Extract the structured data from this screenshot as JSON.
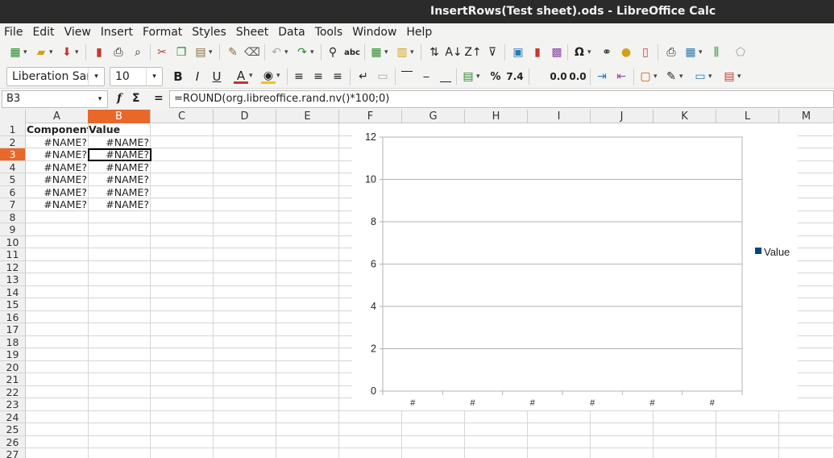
{
  "window": {
    "title": "InsertRows(Test sheet).ods - LibreOffice Calc"
  },
  "menu": [
    "File",
    "Edit",
    "View",
    "Insert",
    "Format",
    "Styles",
    "Sheet",
    "Data",
    "Tools",
    "Window",
    "Help"
  ],
  "formatting": {
    "font_name": "Liberation Sar",
    "font_size": "10"
  },
  "formula_bar": {
    "name_box": "B3",
    "fx": "f",
    "sigma": "Σ",
    "equals": "=",
    "formula": "=ROUND(org.libreoffice.rand.nv()*100;0)"
  },
  "sheet": {
    "columns": [
      "A",
      "B",
      "C",
      "D",
      "E",
      "F",
      "G",
      "H",
      "I",
      "J",
      "K",
      "L",
      "M"
    ],
    "selected_column": "B",
    "rows": [
      "1",
      "2",
      "3",
      "4",
      "5",
      "6",
      "7",
      "8",
      "9",
      "10",
      "11",
      "12",
      "13",
      "14",
      "15",
      "16",
      "17",
      "18",
      "19",
      "20",
      "21",
      "22",
      "23",
      "24",
      "25",
      "26",
      "27"
    ],
    "selected_row": "3",
    "cells": {
      "A1": "Component",
      "B1": "Value",
      "A2": "#NAME?",
      "B2": "#NAME?",
      "A3": "#NAME?",
      "B3": "#NAME?",
      "A4": "#NAME?",
      "B4": "#NAME?",
      "A5": "#NAME?",
      "B5": "#NAME?",
      "A6": "#NAME?",
      "B6": "#NAME?",
      "A7": "#NAME?",
      "B7": "#NAME?"
    }
  },
  "chart_data": {
    "type": "bar",
    "categories": [
      "#",
      "#",
      "#",
      "#",
      "#",
      "#"
    ],
    "series": [
      {
        "name": "Value",
        "values": [
          0,
          0,
          0,
          0,
          0,
          0
        ],
        "color": "#004586"
      }
    ],
    "y_ticks": [
      "0",
      "2",
      "4",
      "6",
      "8",
      "10",
      "12"
    ],
    "ylim": [
      0,
      12
    ],
    "grid": true,
    "legend": "right"
  }
}
